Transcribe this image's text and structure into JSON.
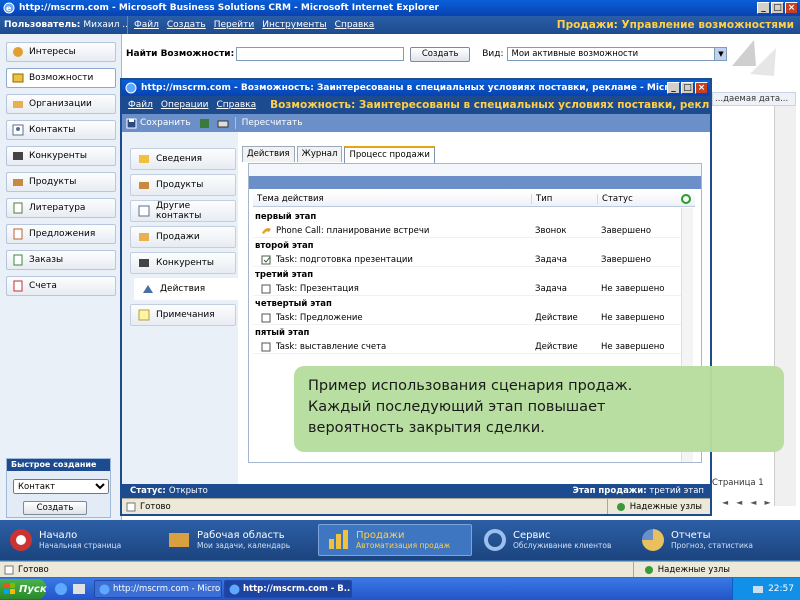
{
  "browser": {
    "title": "http://mscrm.com - Microsoft Business Solutions CRM - Microsoft Internet Explorer",
    "status_text": "Готово",
    "zone_text": "Надежные узлы"
  },
  "crm": {
    "user_label": "Пользователь:",
    "user_name": "Михаил ...",
    "menu": [
      "Файл",
      "Создать",
      "Перейти",
      "Инструменты",
      "Справка"
    ],
    "area_title": "Продажи: Управление возможностями",
    "find_label": "Найти Возможности:",
    "find_value": "",
    "create_button": "Создать",
    "view_label": "Вид:",
    "view_value": "Мои активные возможности",
    "behind_column": "...даемая дата...",
    "paging": "Страница 1",
    "nav": [
      {
        "label": "Интересы",
        "icon": "leads-icon"
      },
      {
        "label": "Возможности",
        "icon": "opportunities-icon"
      },
      {
        "label": "Организации",
        "icon": "accounts-icon"
      },
      {
        "label": "Контакты",
        "icon": "contacts-icon"
      },
      {
        "label": "Конкуренты",
        "icon": "competitors-icon"
      },
      {
        "label": "Продукты",
        "icon": "products-icon"
      },
      {
        "label": "Литература",
        "icon": "literature-icon"
      },
      {
        "label": "Предложения",
        "icon": "quotes-icon"
      },
      {
        "label": "Заказы",
        "icon": "orders-icon"
      },
      {
        "label": "Счета",
        "icon": "invoices-icon"
      }
    ],
    "quick_create": {
      "title": "Быстрое создание",
      "selected": "Контакт",
      "button": "Создать"
    }
  },
  "popup": {
    "title": "http://mscrm.com - Возможность: Заинтересованы в специальных условиях поставки, рекламе - Microsoft Intern...",
    "menu": [
      "Файл",
      "Операции",
      "Справка"
    ],
    "opportunity_title": "Возможность: Заинтересованы в специальных условиях поставки, рекламе",
    "toolbar": {
      "save": "Сохранить",
      "recalc": "Пересчитать"
    },
    "nav": [
      {
        "label": "Сведения"
      },
      {
        "label": "Продукты"
      },
      {
        "label": "Другие контакты"
      },
      {
        "label": "Продажи"
      },
      {
        "label": "Конкуренты"
      },
      {
        "label": "Действия"
      },
      {
        "label": "Примечания"
      }
    ],
    "tabs": [
      "Действия",
      "Журнал",
      "Процесс продажи"
    ],
    "grid": {
      "columns": [
        "Тема действия",
        "Тип",
        "Статус"
      ],
      "stages": [
        {
          "name": "первый этап",
          "subject": "Phone Call: планирование встречи",
          "type": "Звонок",
          "status": "Завершено",
          "icon": "phone-icon"
        },
        {
          "name": "второй этап",
          "subject": "Task: подготовка презентации",
          "type": "Задача",
          "status": "Завершено",
          "icon": "task-icon"
        },
        {
          "name": "третий этап",
          "subject": "Task: Презентация",
          "type": "Задача",
          "status": "Не завершено",
          "icon": "task-icon"
        },
        {
          "name": "четвертый этап",
          "subject": "Task: Предложение",
          "type": "Действие",
          "status": "Не завершено",
          "icon": "task-icon"
        },
        {
          "name": "пятый этап",
          "subject": "Task: выставление счета",
          "type": "Действие",
          "status": "Не завершено",
          "icon": "task-icon"
        }
      ]
    },
    "status_label": "Статус:",
    "status_value": "Открыто",
    "stage_label": "Этап продажи:",
    "stage_value": "третий этап",
    "ready": "Готово",
    "zone": "Надежные узлы"
  },
  "callout": {
    "lines": [
      "Пример использования сценария продаж.",
      "Каждый последующий этап повышает",
      "вероятность закрытия сделки."
    ]
  },
  "bottom_nav": [
    {
      "title": "Начало",
      "sub": "Начальная страница",
      "icon": "home-icon"
    },
    {
      "title": "Рабочая область",
      "sub": "Мои задачи, календарь",
      "icon": "workplace-icon"
    },
    {
      "title": "Продажи",
      "sub": "Автоматизация продаж",
      "icon": "sales-icon"
    },
    {
      "title": "Сервис",
      "sub": "Обслуживание клиентов",
      "icon": "service-icon"
    },
    {
      "title": "Отчеты",
      "sub": "Прогноз, статистика",
      "icon": "reports-icon"
    }
  ],
  "taskbar": {
    "start": "Пуск",
    "tasks": [
      "http://mscrm.com - Micro...",
      "http://mscrm.com - B..."
    ],
    "clock": "22:57"
  },
  "colors": {
    "title_blue": "#0a5fd8",
    "crm_blue": "#1d4b8f",
    "accent_yellow": "#ffd04a",
    "callout_green": "#b7dd9e"
  }
}
